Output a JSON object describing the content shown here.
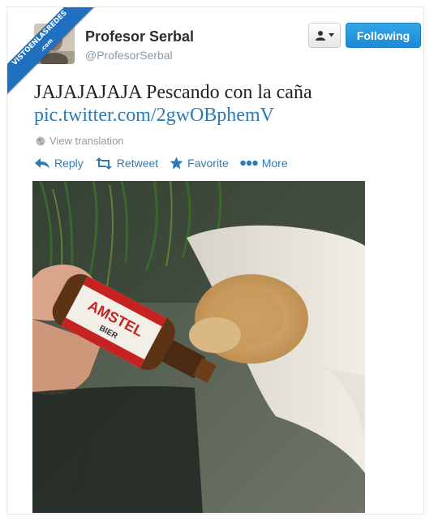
{
  "watermark": {
    "line1": "VISTOENLASREDES",
    "line2": ".com"
  },
  "user": {
    "name": "Profesor Serbal",
    "handle": "@ProfesorSerbal"
  },
  "buttons": {
    "following_label": "Following",
    "user_menu_icon": "person-dropdown-icon"
  },
  "tweet": {
    "text": "JAJAJAJAJA Pescando con la caña",
    "link": "pic.twitter.com/2gwOBphemV",
    "translation_label": "View translation"
  },
  "actions": [
    {
      "label": "Reply",
      "icon": "reply-icon"
    },
    {
      "label": "Retweet",
      "icon": "retweet-icon"
    },
    {
      "label": "Favorite",
      "icon": "star-icon"
    },
    {
      "label": "More",
      "icon": "more-dots-icon"
    }
  ],
  "photo": {
    "bottle_brand": "AMSTEL",
    "bottle_sub": "BIER"
  },
  "colors": {
    "accent": "#2b7bb9",
    "follow_button": "#1d8ad3",
    "watermark": "#1f70c1"
  }
}
